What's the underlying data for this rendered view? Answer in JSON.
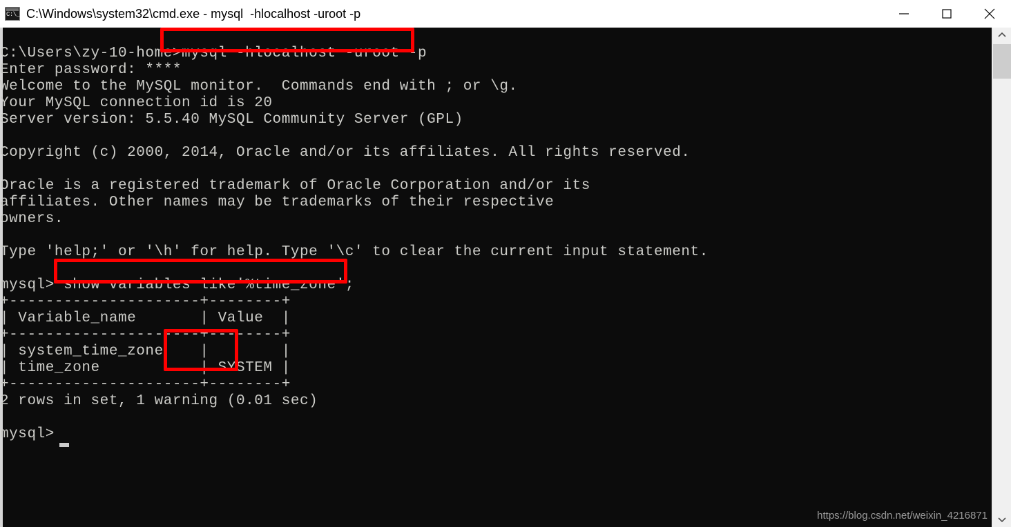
{
  "window": {
    "title": "C:\\Windows\\system32\\cmd.exe - mysql  -hlocalhost -uroot -p",
    "icon_label": "C:\\_",
    "background_color": "#0c0c0c",
    "foreground_color": "#ccccc8",
    "titlebar_color": "#ffffff",
    "controls": {
      "minimize_label": "Minimize",
      "maximize_label": "Maximize",
      "close_label": "Close"
    }
  },
  "terminal": {
    "content": "C:\\Users\\zy-10-home>mysql -hlocalhost -uroot -p\nEnter password: ****\nWelcome to the MySQL monitor.  Commands end with ; or \\g.\nYour MySQL connection id is 20\nServer version: 5.5.40 MySQL Community Server (GPL)\n\nCopyright (c) 2000, 2014, Oracle and/or its affiliates. All rights reserved.\n\nOracle is a registered trademark of Oracle Corporation and/or its\naffiliates. Other names may be trademarks of their respective\nowners.\n\nType 'help;' or '\\h' for help. Type '\\c' to clear the current input statement.\n\nmysql> show variables like'%time_zone';\n+---------------------+--------+\n| Variable_name       | Value  |\n+---------------------+--------+\n| system_time_zone    |        |\n| time_zone           | SYSTEM |\n+---------------------+--------+\n2 rows in set, 1 warning (0.01 sec)\n\nmysql> ",
    "prompt_path": "C:\\Users\\zy-10-home>",
    "command_typed": "mysql -hlocalhost -uroot -p",
    "password_prompt": "Enter password: ****",
    "sql_prompt": "mysql>",
    "sql_query": "show variables like'%time_zone';",
    "result_summary": "2 rows in set, 1 warning (0.01 sec)",
    "result_table": {
      "headers": [
        "Variable_name",
        "Value"
      ],
      "rows": [
        [
          "system_time_zone",
          ""
        ],
        [
          "time_zone",
          "SYSTEM"
        ]
      ]
    },
    "server_info": {
      "welcome": "Welcome to the MySQL monitor.  Commands end with ; or \\g.",
      "connection_id": "Your MySQL connection id is 20",
      "server_version": "Server version: 5.5.40 MySQL Community Server (GPL)"
    }
  },
  "annotations": {
    "color": "#fe0000",
    "boxes": [
      {
        "name": "mysql-login-command",
        "target": "mysql -hlocalhost -uroot -p"
      },
      {
        "name": "show-variables-query",
        "target": "show variables like'%time_zone';"
      },
      {
        "name": "time-zone-value",
        "target": "SYSTEM"
      }
    ]
  },
  "watermark": {
    "text": "https://blog.csdn.net/weixin_4216871"
  },
  "scrollbar": {
    "up_arrow": "⌃",
    "down_arrow": "⌄"
  }
}
